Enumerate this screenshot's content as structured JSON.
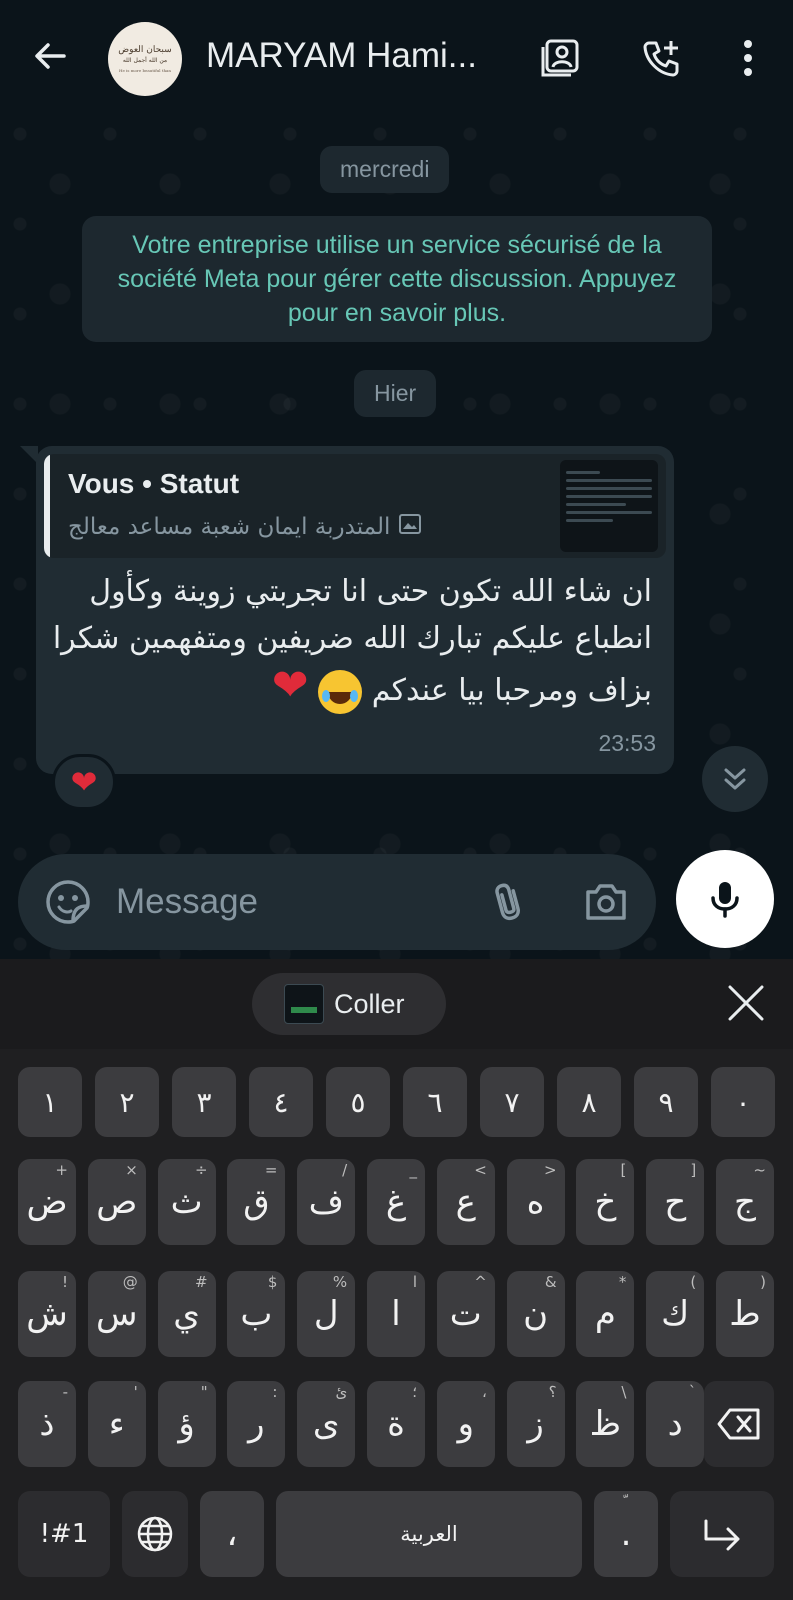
{
  "header": {
    "contact_name": "MARYAM Hami...",
    "avatar_text": [
      "سبحان العوض",
      "من الله أجمل الله",
      "He is more beautiful than"
    ]
  },
  "chat": {
    "date_chip_1": "mercredi",
    "system_message": "Votre entreprise utilise un service sécurisé de la société Meta pour gérer cette discussion. Appuyez pour en savoir plus.",
    "date_chip_2": "Hier",
    "message": {
      "quote_title": "Vous • Statut",
      "quote_subtitle": "المتدربة ايمان شعبة مساعد معالج",
      "text": "ان شاء الله تكون حتى انا تجربتي زوينة وكأول انطباع عليكم تبارك الله ضريفين ومتفهمين شكرا بزاف ومرحبا بيا عندكم",
      "emojis": [
        "😂",
        "❤️"
      ],
      "time": "23:53",
      "reaction": "❤️"
    }
  },
  "input": {
    "placeholder": "Message"
  },
  "keyboard": {
    "paste_label": "Coller",
    "row_numbers": [
      "١",
      "٢",
      "٣",
      "٤",
      "٥",
      "٦",
      "٧",
      "٨",
      "٩",
      "٠"
    ],
    "row1": [
      {
        "key": "ض",
        "alt": "+"
      },
      {
        "key": "ص",
        "alt": "×"
      },
      {
        "key": "ث",
        "alt": "÷"
      },
      {
        "key": "ق",
        "alt": "="
      },
      {
        "key": "ف",
        "alt": "/"
      },
      {
        "key": "غ",
        "alt": "_"
      },
      {
        "key": "ع",
        "alt": "<"
      },
      {
        "key": "ه",
        "alt": ">"
      },
      {
        "key": "خ",
        "alt": "["
      },
      {
        "key": "ح",
        "alt": "]"
      },
      {
        "key": "ج",
        "alt": "~"
      }
    ],
    "row2": [
      {
        "key": "ش",
        "alt": "!"
      },
      {
        "key": "س",
        "alt": "@"
      },
      {
        "key": "ي",
        "alt": "#"
      },
      {
        "key": "ب",
        "alt": "$"
      },
      {
        "key": "ل",
        "alt": "%"
      },
      {
        "key": "ا",
        "alt": "ا"
      },
      {
        "key": "ت",
        "alt": "^"
      },
      {
        "key": "ن",
        "alt": "&"
      },
      {
        "key": "م",
        "alt": "*"
      },
      {
        "key": "ك",
        "alt": "("
      },
      {
        "key": "ط",
        "alt": ")"
      }
    ],
    "row3": [
      {
        "key": "ذ",
        "alt": "-"
      },
      {
        "key": "ء",
        "alt": "'"
      },
      {
        "key": "ؤ",
        "alt": "\""
      },
      {
        "key": "ر",
        "alt": ":"
      },
      {
        "key": "ى",
        "alt": "ئ"
      },
      {
        "key": "ة",
        "alt": "؛"
      },
      {
        "key": "و",
        "alt": "،"
      },
      {
        "key": "ز",
        "alt": "؟"
      },
      {
        "key": "ظ",
        "alt": "\\"
      },
      {
        "key": "د",
        "alt": "`"
      }
    ],
    "symbols_label": "!#1",
    "comma_label": "،",
    "space_label": "العربية",
    "period_label": ".",
    "period_alt": "ّ"
  }
}
